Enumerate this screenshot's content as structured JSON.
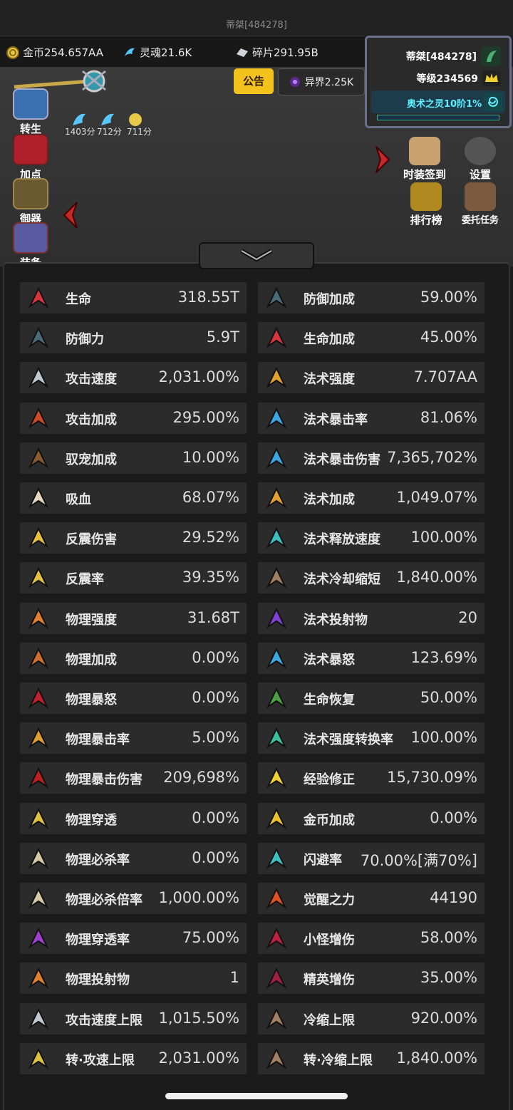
{
  "window_title": "蒂桀[484278]",
  "resources": [
    {
      "label": "金币254.657AA",
      "icon": "gold-coin-icon",
      "color": "#e6c84a"
    },
    {
      "label": "灵魂21.6K",
      "icon": "soul-icon",
      "color": "#59c7ff"
    },
    {
      "label": "碎片291.95B",
      "icon": "shard-icon",
      "color": "#cfd4dc"
    }
  ],
  "profile": {
    "name": "蒂桀[484278]",
    "level": "等级234569",
    "arcane": "奥术之灵10阶1%"
  },
  "top_buttons": {
    "notice": "公告",
    "otherworld": "异界2.25K"
  },
  "left_menu": [
    {
      "label": "转生",
      "icon": "rebirth-icon",
      "color": "#3a6fb0"
    },
    {
      "label": "加点",
      "icon": "blood-drop-icon",
      "color": "#b0202a"
    },
    {
      "label": "御器",
      "icon": "sword-icon",
      "color": "#a08850"
    },
    {
      "label": "装备",
      "icon": "equipment-icon",
      "color": "#5a5aa0"
    }
  ],
  "skill_times": [
    "1403分",
    "712分",
    "711分"
  ],
  "right_menu": [
    {
      "label": "时装签到",
      "icon": "new-badge-icon",
      "color": "#c9a070"
    },
    {
      "label": "设置",
      "icon": "gear-icon",
      "color": "#888888"
    },
    {
      "label": "排行榜",
      "icon": "trophy-icon",
      "color": "#e0b030"
    },
    {
      "label": "委托任务",
      "icon": "scroll-icon",
      "color": "#a07050"
    }
  ],
  "stats_left": [
    {
      "label": "生命",
      "value": "318.55T",
      "icon": "heart-icon",
      "color": "#d8343c"
    },
    {
      "label": "防御力",
      "value": "5.9T",
      "icon": "shield-icon",
      "color": "#4a6a78"
    },
    {
      "label": "攻击速度",
      "value": "2,031.00%",
      "icon": "sword-speed-icon",
      "color": "#c0c8d0"
    },
    {
      "label": "攻击加成",
      "value": "295.00%",
      "icon": "crossed-swords-icon",
      "color": "#d04a2a"
    },
    {
      "label": "驭宠加成",
      "value": "10.00%",
      "icon": "paw-icon",
      "color": "#8a5a30"
    },
    {
      "label": "吸血",
      "value": "68.07%",
      "icon": "vampire-skull-icon",
      "color": "#e8d8c0"
    },
    {
      "label": "反震伤害",
      "value": "29.52%",
      "icon": "recoil-star-icon",
      "color": "#e8c040"
    },
    {
      "label": "反震率",
      "value": "39.35%",
      "icon": "recoil-rate-icon",
      "color": "#e0c040"
    },
    {
      "label": "物理强度",
      "value": "31.68T",
      "icon": "physical-power-icon",
      "color": "#e08030"
    },
    {
      "label": "物理加成",
      "value": "0.00%",
      "icon": "physical-bonus-icon",
      "color": "#d07030"
    },
    {
      "label": "物理暴怒",
      "value": "0.00%",
      "icon": "physical-fury-icon",
      "color": "#c02030"
    },
    {
      "label": "物理暴击率",
      "value": "5.00%",
      "icon": "physical-crit-icon",
      "color": "#e0a030"
    },
    {
      "label": "物理暴击伤害",
      "value": "209,698%",
      "icon": "physical-crit-dmg-icon",
      "color": "#c02020"
    },
    {
      "label": "物理穿透",
      "value": "0.00%",
      "icon": "penetration-icon",
      "color": "#e0c040"
    },
    {
      "label": "物理必杀率",
      "value": "0.00%",
      "icon": "skull-icon",
      "color": "#d8c8a8"
    },
    {
      "label": "物理必杀倍率",
      "value": "1,000.00%",
      "icon": "skull-multiplier-icon",
      "color": "#d8c8a8"
    },
    {
      "label": "物理穿透率",
      "value": "75.00%",
      "icon": "penetration-rate-icon",
      "color": "#a040d0"
    },
    {
      "label": "物理投射物",
      "value": "1",
      "icon": "projectile-icon",
      "color": "#e08030"
    },
    {
      "label": "攻击速度上限",
      "value": "1,015.50%",
      "icon": "attack-speed-cap-icon",
      "color": "#c0c8d0"
    },
    {
      "label": "转·攻速上限",
      "value": "2,031.00%",
      "icon": "transfer-speed-cap-icon",
      "color": "#e0c040"
    }
  ],
  "stats_right": [
    {
      "label": "防御加成",
      "value": "59.00%",
      "icon": "defense-bonus-icon",
      "color": "#4a6a78"
    },
    {
      "label": "生命加成",
      "value": "45.00%",
      "icon": "life-bonus-icon",
      "color": "#d8343c"
    },
    {
      "label": "法术强度",
      "value": "7.707AA",
      "icon": "spell-power-icon",
      "color": "#e0a030"
    },
    {
      "label": "法术暴击率",
      "value": "81.06%",
      "icon": "spell-crit-icon",
      "color": "#3aa8e0"
    },
    {
      "label": "法术暴击伤害",
      "value": "7,365,702%",
      "icon": "spell-crit-dmg-icon",
      "color": "#3aa8e0"
    },
    {
      "label": "法术加成",
      "value": "1,049.07%",
      "icon": "spell-bonus-icon",
      "color": "#e0a030"
    },
    {
      "label": "法术释放速度",
      "value": "100.00%",
      "icon": "cast-speed-icon",
      "color": "#3ac0c0"
    },
    {
      "label": "法术冷却缩短",
      "value": "1,840.00%",
      "icon": "hourglass-icon",
      "color": "#a08060"
    },
    {
      "label": "法术投射物",
      "value": "20",
      "icon": "spell-projectile-icon",
      "color": "#8040d0"
    },
    {
      "label": "法术暴怒",
      "value": "123.69%",
      "icon": "spell-fury-icon",
      "color": "#3aa8e0"
    },
    {
      "label": "生命恢复",
      "value": "50.00%",
      "icon": "sprout-icon",
      "color": "#4aa040"
    },
    {
      "label": "法术强度转换率",
      "value": "100.00%",
      "icon": "conversion-icon",
      "color": "#3ac0a0"
    },
    {
      "label": "经验修正",
      "value": "15,730.09%",
      "icon": "crown-icon",
      "color": "#f0d030"
    },
    {
      "label": "金币加成",
      "value": "0.00%",
      "icon": "coins-icon",
      "color": "#e8c030"
    },
    {
      "label": "闪避率",
      "value": "70.00%[满70%]",
      "icon": "dodge-icon",
      "color": "#3ac0c0"
    },
    {
      "label": "觉醒之力",
      "value": "44190",
      "icon": "awakening-icon",
      "color": "#e05020"
    },
    {
      "label": "小怪增伤",
      "value": "58.00%",
      "icon": "minion-demon-icon",
      "color": "#c02040"
    },
    {
      "label": "精英增伤",
      "value": "35.00%",
      "icon": "elite-demon-icon",
      "color": "#a02040"
    },
    {
      "label": "冷缩上限",
      "value": "920.00%",
      "icon": "cooldown-cap-icon",
      "color": "#a08060"
    },
    {
      "label": "转·冷缩上限",
      "value": "1,840.00%",
      "icon": "transfer-cooldown-cap-icon",
      "color": "#a08060"
    }
  ]
}
